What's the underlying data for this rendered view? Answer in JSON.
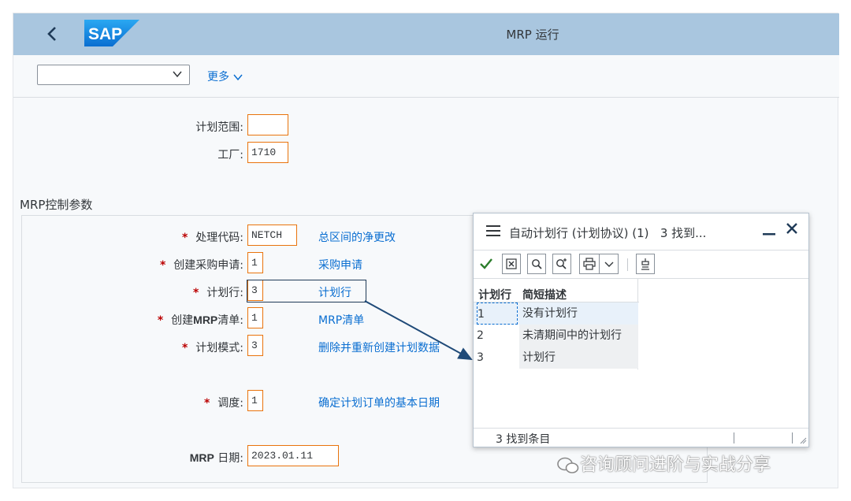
{
  "header": {
    "title": "MRP 运行",
    "logo_text": "SAP"
  },
  "toolbar": {
    "variant_value": "",
    "more_label": "更多"
  },
  "selection": {
    "plan_scope_label": "计划范围:",
    "plan_scope_value": "",
    "plant_label": "工厂:",
    "plant_value": "1710"
  },
  "group": {
    "title": "MRP控制参数",
    "rows": [
      {
        "label": "处理代码:",
        "value": "NETCH",
        "desc": "总区间的净更改"
      },
      {
        "label": "创建采购申请:",
        "value": "1",
        "desc": "采购申请"
      },
      {
        "label": "计划行:",
        "value": "3",
        "desc": "计划行"
      },
      {
        "label_pre": "创建",
        "label_bold": "MRP",
        "label_post": "清单:",
        "value": "1",
        "desc": "MRP清单"
      },
      {
        "label": "计划模式:",
        "value": "3",
        "desc": "删除并重新创建计划数据"
      },
      {
        "label": "调度:",
        "value": "1",
        "desc": "确定计划订单的基本日期"
      }
    ],
    "date_label_bold": "MRP",
    "date_label_rest": " 日期:",
    "date_value": "2023.01.11"
  },
  "popup": {
    "title": "自动计划行 (计划协议) (1)",
    "found_short": "3 找到...",
    "col1": "计划行",
    "col2": "简短描述",
    "rows": [
      {
        "key": "1",
        "desc": "没有计划行"
      },
      {
        "key": "2",
        "desc": "未清期间中的计划行"
      },
      {
        "key": "3",
        "desc": "计划行"
      }
    ],
    "status": "3 找到条目"
  },
  "watermark": "咨询顾问进阶与实战分享",
  "colors": {
    "shellbar": "#a9c6df",
    "accent": "#0a6ed1",
    "required": "#bb0000",
    "field_border": "#e9730c"
  }
}
